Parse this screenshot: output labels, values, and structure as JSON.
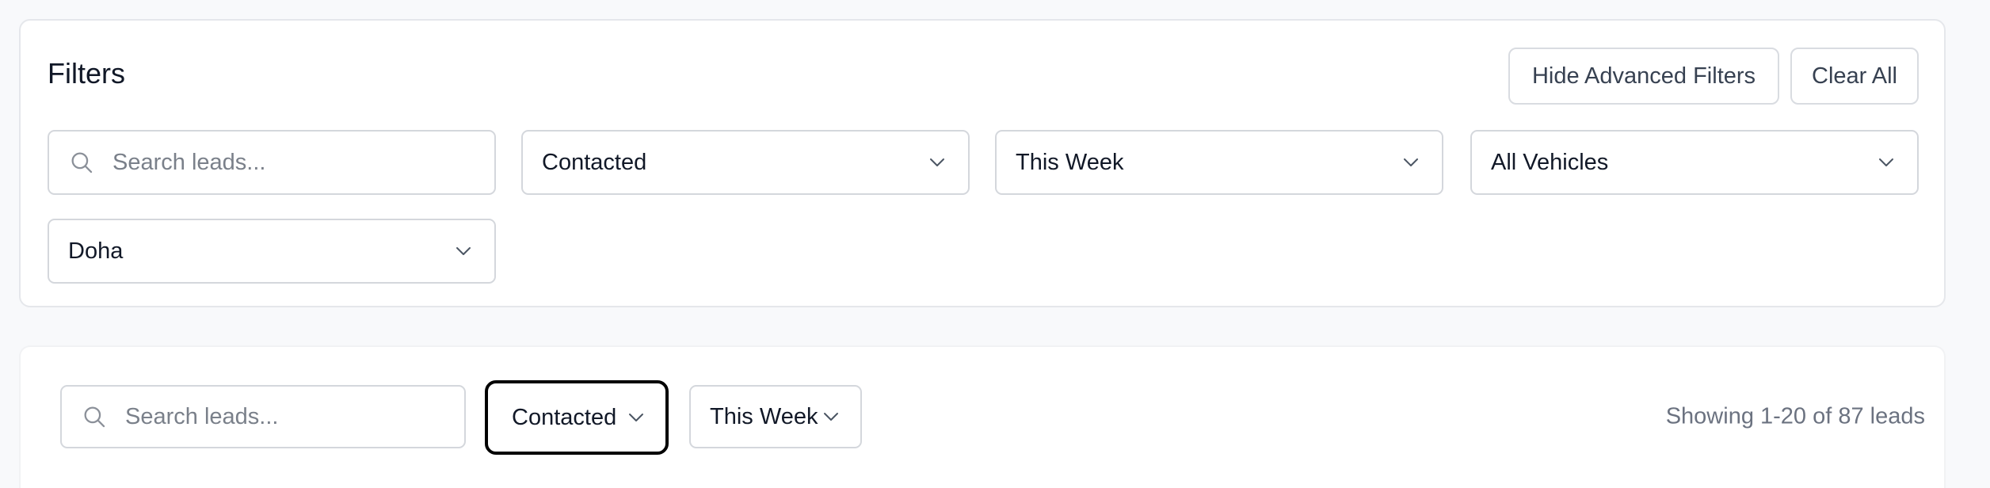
{
  "filters": {
    "title": "Filters",
    "hide_advanced_label": "Hide Advanced Filters",
    "clear_all_label": "Clear All",
    "search_placeholder": "Search leads...",
    "status_value": "Contacted",
    "date_value": "This Week",
    "vehicle_value": "All Vehicles",
    "city_value": "Doha"
  },
  "quickbar": {
    "search_placeholder": "Search leads...",
    "status_value": "Contacted",
    "date_value": "This Week",
    "results_text": "Showing 1-20 of 87 leads"
  },
  "icons": {
    "search": "search-icon",
    "dropdown": "chevron-down-icon"
  },
  "colors": {
    "page_bg": "#f8f9fb",
    "border": "#d4d7dc",
    "muted_text": "#6b7280",
    "focus_ring": "#000000"
  }
}
